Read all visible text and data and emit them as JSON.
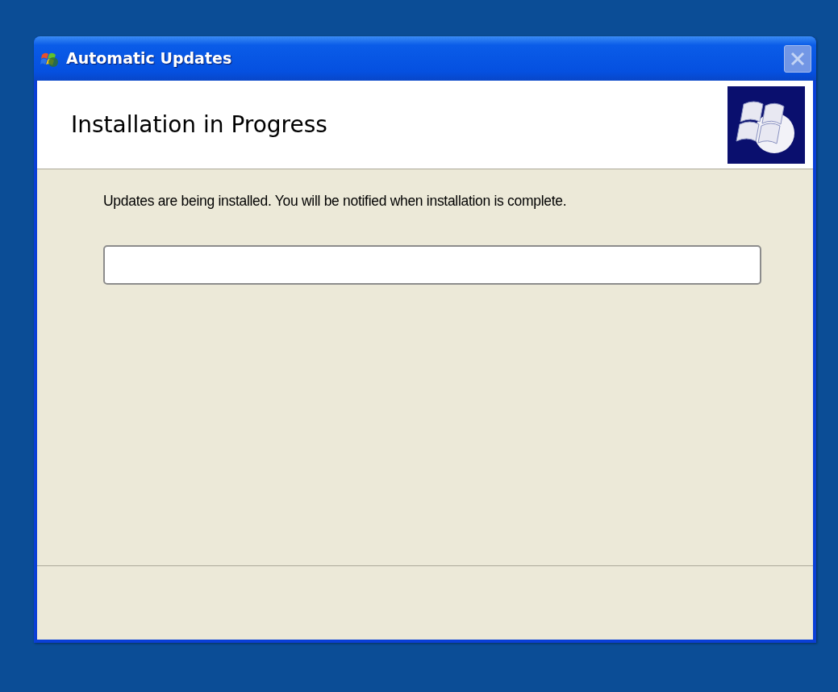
{
  "window": {
    "title": "Automatic Updates",
    "close_disabled": true
  },
  "header": {
    "title": "Installation in Progress"
  },
  "message": "Updates are being installed. You will be notified when installation is complete.",
  "progress": {
    "level": 0
  }
}
